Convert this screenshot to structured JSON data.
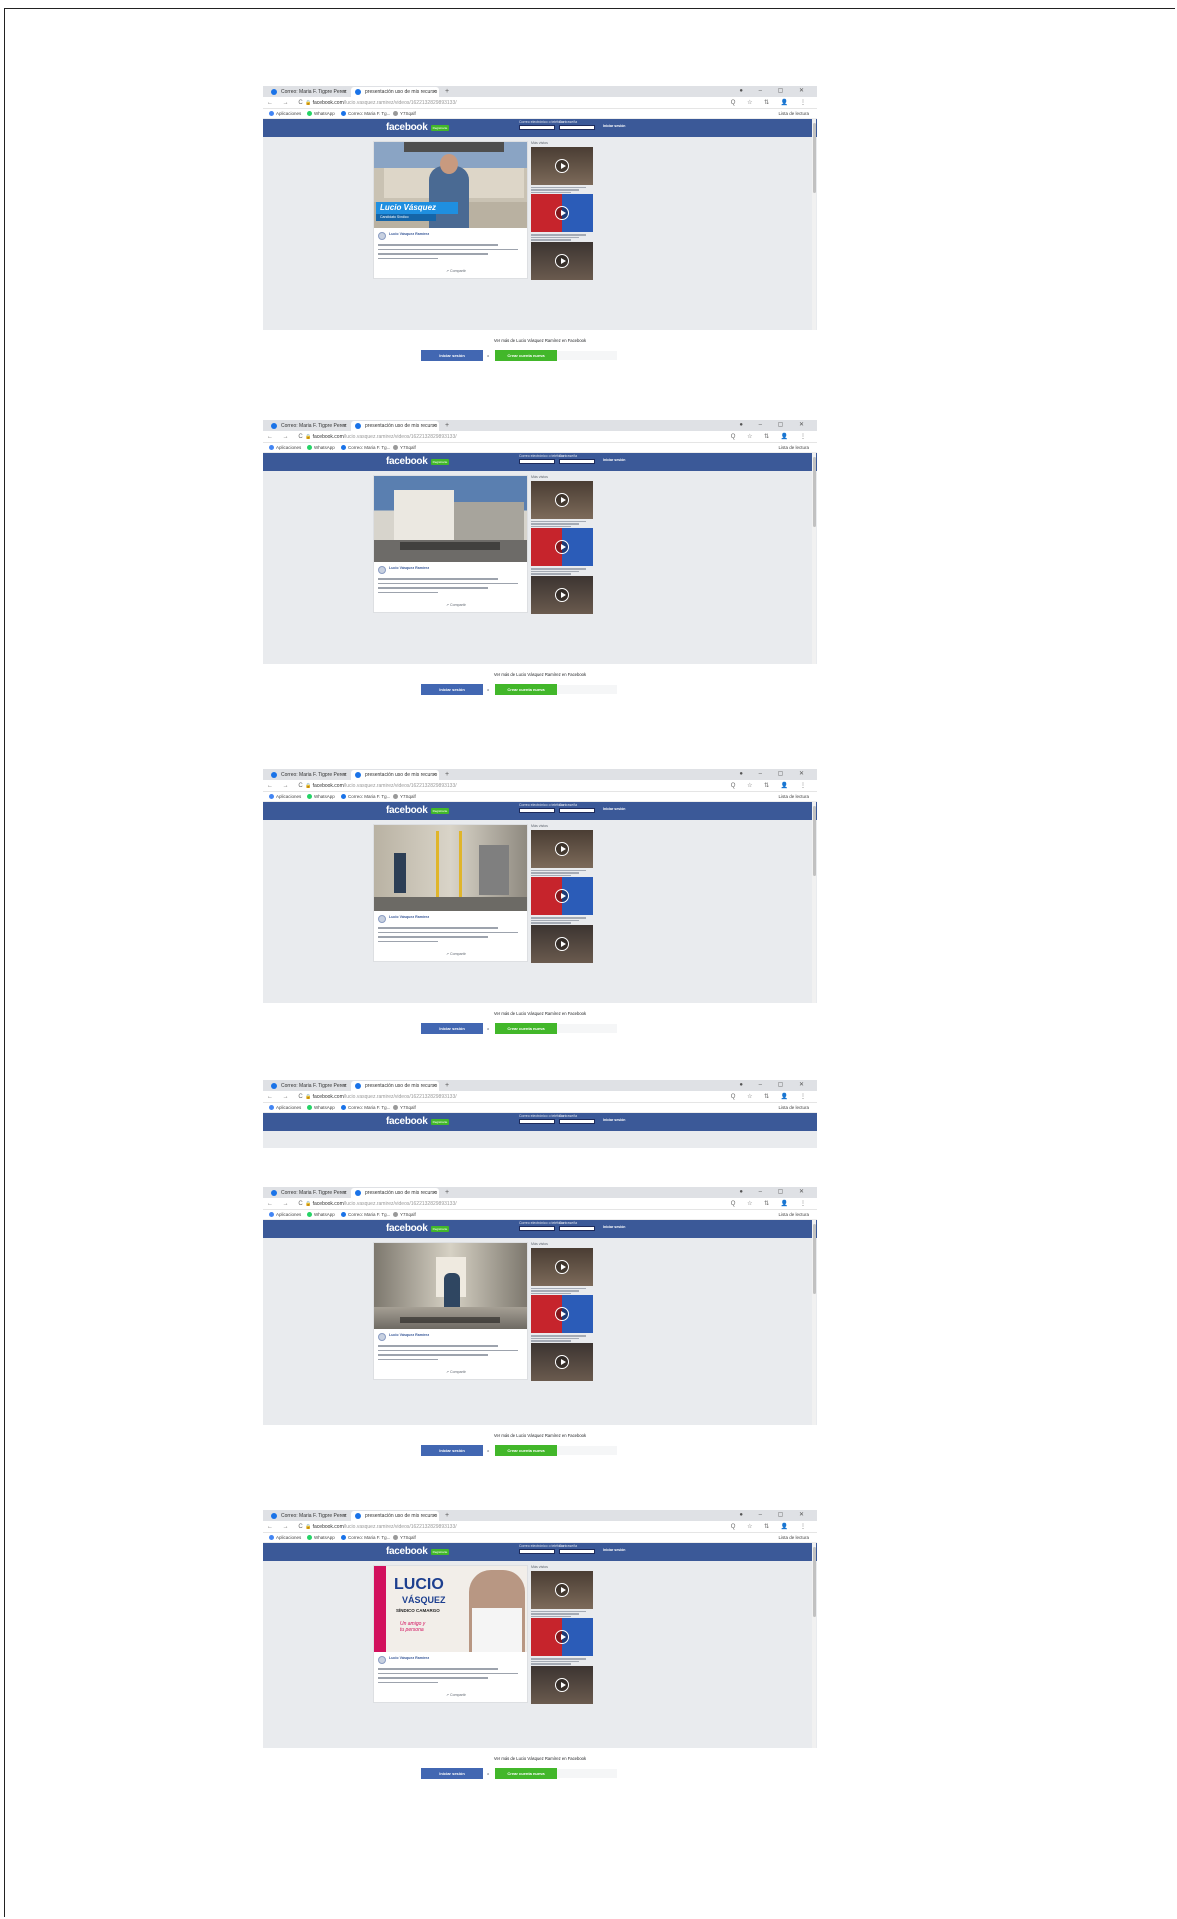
{
  "document": {
    "title": ""
  },
  "browser": {
    "tab1": "Correo: Maria F. Tigpre Perez",
    "tab2": "presentación uso de mis recurso",
    "new_tab": "+",
    "window_controls": "●  –  ▢  ✕",
    "nav_buttons": "← → C",
    "url_host": "facebook.com",
    "url_path": "/lucio.vasquez.ramirez/videos/1622132829893133/",
    "extensions": "Q ☆ ⇅ 👤 ⋮",
    "bookmarks": [
      "Aplicaciones",
      "WhatsApp",
      "Correo: Maria F. Tg...",
      "Y7Sqalf"
    ],
    "reading_list": "Lista de lectura"
  },
  "facebook": {
    "logo": "facebook",
    "register": "Registrarte",
    "email_label": "Correo electrónico o teléfono",
    "password_label": "Contraseña",
    "login": "Iniciar sesión",
    "video_name_overlay": "Lucio Vásquez",
    "video_name_sub": "Candidato Síndico",
    "poster_headline": "LUCIO",
    "poster_sub": "VÁSQUEZ",
    "poster_role": "SÍNDICO CAMARGO",
    "poster_slogan": "Un amigo y tu persona",
    "author": "Lucio Vásquez Ramírez",
    "share": "Compartir",
    "related_title": "Más vistos",
    "footer_text": "Ver más de Lucio Vásquez Ramírez en Facebook",
    "login_button": "Iniciar sesión",
    "or": "o",
    "create_button": "Crear cuenta nueva"
  },
  "colors": {
    "fb_blue": "#3b5998",
    "fb_green": "#42b72a",
    "page_bg": "#e9ebee"
  }
}
